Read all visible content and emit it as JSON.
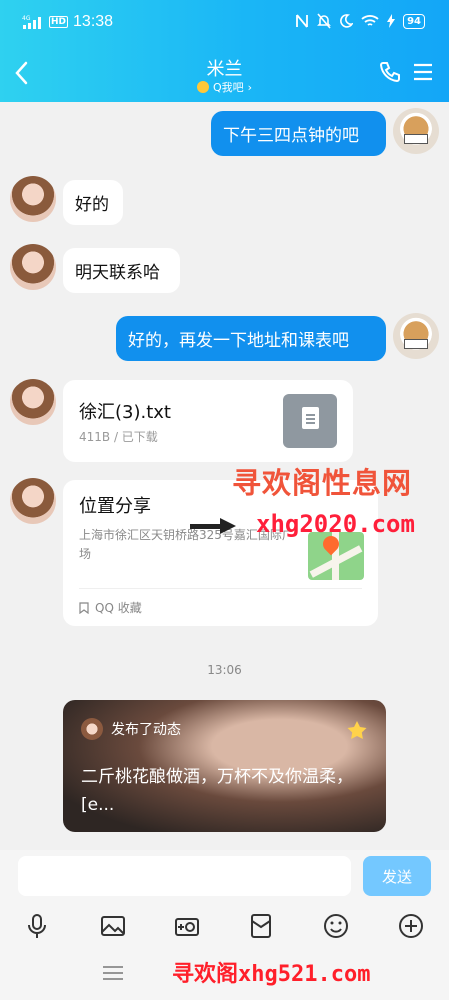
{
  "status_bar": {
    "time": "13:38",
    "network": "4G",
    "hd_badge": "HD",
    "battery": "94"
  },
  "chat_header": {
    "title": "米兰",
    "subtitle": "Q我吧",
    "subtitle_chevron": "›",
    "icons": [
      "back-arrow-icon",
      "phone-icon",
      "menu-icon"
    ]
  },
  "messages": [
    {
      "sender": "self",
      "type": "text",
      "text": "下午三四点钟的吧"
    },
    {
      "sender": "contact",
      "type": "text",
      "text": "好的"
    },
    {
      "sender": "contact",
      "type": "text",
      "text": "明天联系哈"
    },
    {
      "sender": "self",
      "type": "text",
      "text": "好的，再发一下地址和课表吧"
    },
    {
      "sender": "contact",
      "type": "file",
      "name": "徐汇(3).txt",
      "meta": "411B / 已下载"
    },
    {
      "sender": "contact",
      "type": "location",
      "title": "位置分享",
      "address": "上海市徐汇区天钥桥路325号嘉汇国际广场",
      "source": "QQ 收藏"
    }
  ],
  "timestamp": "13:06",
  "post_card": {
    "label": "发布了动态",
    "text": "二斤桃花酿做酒，万杯不及你温柔，[e..."
  },
  "watermarks": {
    "line1": "寻欢阁性息网",
    "line2": "xhg2020.com",
    "line3": "寻欢阁xhg521.com"
  },
  "composer": {
    "input_value": "",
    "send_label": "发送"
  },
  "toolbar_icons": [
    "microphone-icon",
    "image-icon",
    "camera-icon",
    "red-packet-icon",
    "emoji-icon",
    "plus-icon"
  ],
  "colors": {
    "header_start": "#2fd1f0",
    "header_end": "#13a6f7",
    "outgoing_bubble": "#1190ee",
    "send_button": "#74c8ff",
    "watermark": "#ff2a2a"
  }
}
